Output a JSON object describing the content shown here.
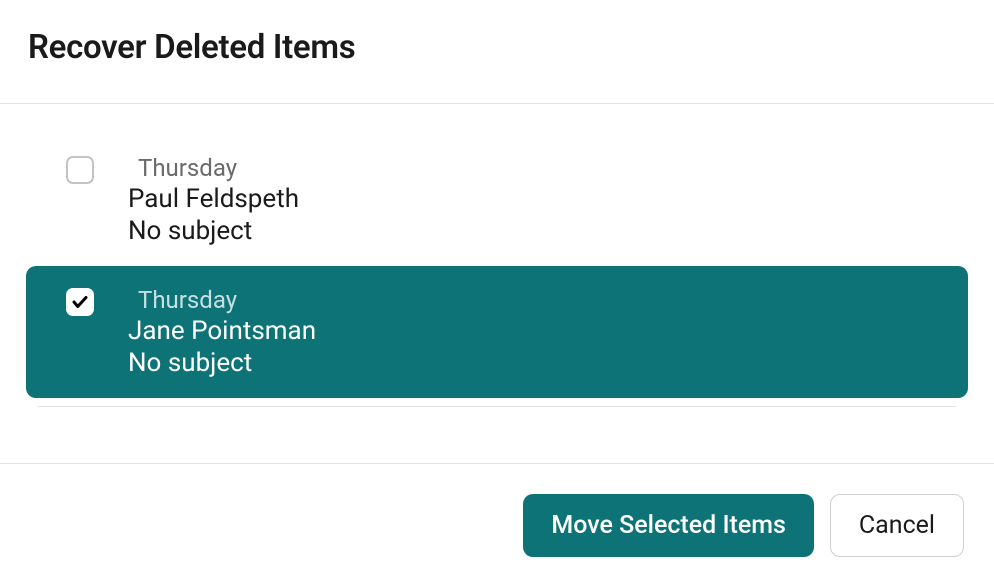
{
  "dialog": {
    "title": "Recover Deleted Items"
  },
  "items": [
    {
      "date": "Thursday",
      "sender": "Paul Feldspeth",
      "subject": "No subject",
      "checked": false
    },
    {
      "date": "Thursday",
      "sender": "Jane Pointsman",
      "subject": "No subject",
      "checked": true
    }
  ],
  "footer": {
    "move_label": "Move Selected Items",
    "cancel_label": "Cancel"
  },
  "colors": {
    "accent": "#0d7377"
  }
}
